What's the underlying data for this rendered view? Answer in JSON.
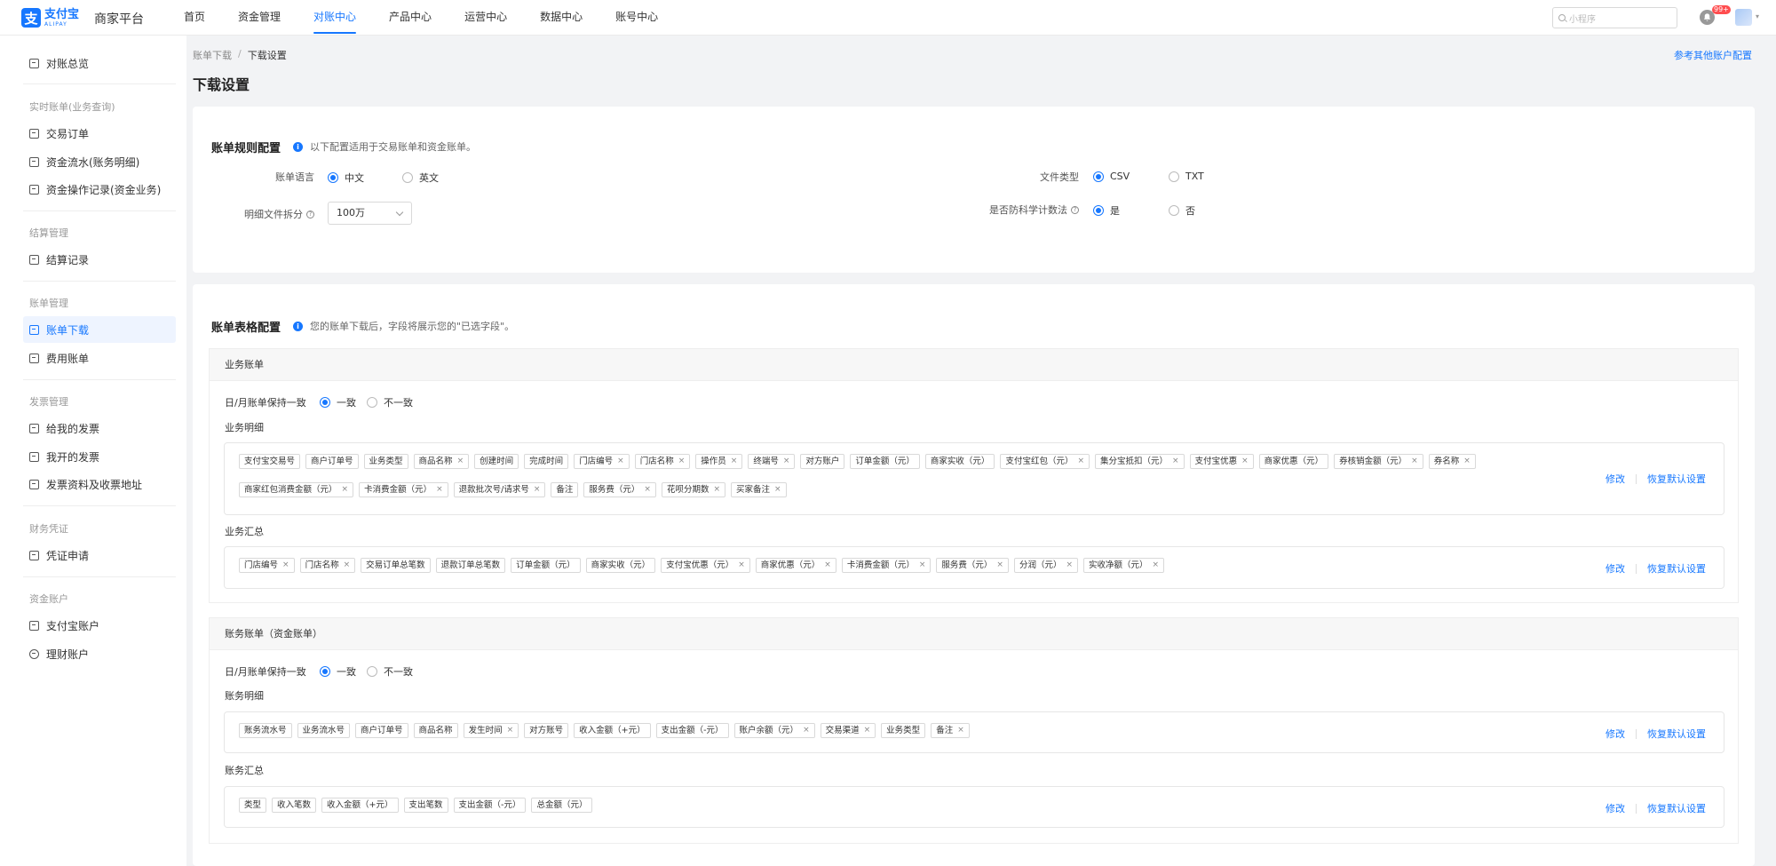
{
  "brand": {
    "logo_cn": "支付宝",
    "logo_en": "ALIPAY",
    "platform": "商家平台",
    "accent": "#1677ff"
  },
  "nav": [
    "首页",
    "资金管理",
    "对账中心",
    "产品中心",
    "运营中心",
    "数据中心",
    "账号中心"
  ],
  "nav_active": "对账中心",
  "search": {
    "placeholder": "小程序"
  },
  "notifications": "99+",
  "sidebar": {
    "top": "对账总览",
    "group1": "实时账单(业务查询)",
    "g1_items": [
      "交易订单",
      "资金流水(账务明细)",
      "资金操作记录(资金业务)"
    ],
    "group2": "结算管理",
    "g2_items": [
      "结算记录"
    ],
    "group3": "账单管理",
    "g3_items": [
      "账单下载",
      "费用账单"
    ],
    "group4": "发票管理",
    "g4_items": [
      "给我的发票",
      "我开的发票",
      "发票资料及收票地址"
    ],
    "group5": "财务凭证",
    "g5_items": [
      "凭证申请"
    ],
    "group6": "资金账户",
    "g6_items": [
      "支付宝账户",
      "理财账户"
    ]
  },
  "breadcrumb": [
    "账单下载",
    "下载设置"
  ],
  "page_title": "下载设置",
  "ref_link": "参考其他账户配置",
  "rules": {
    "title": "账单规则配置",
    "tip": "以下配置适用于交易账单和资金账单。",
    "lang_label": "账单语言",
    "lang_options": [
      "中文",
      "英文"
    ],
    "lang_selected": "中文",
    "split_label": "明细文件拆分",
    "split_value": "100万",
    "filetype_label": "文件类型",
    "filetype_options": [
      "CSV",
      "TXT"
    ],
    "filetype_selected": "CSV",
    "sci_label": "是否防科学计数法",
    "sci_options": [
      "是",
      "否"
    ],
    "sci_selected": "是"
  },
  "table_config": {
    "title": "账单表格配置",
    "tip": "您的账单下载后，字段将展示您的\"已选字段\"。",
    "consistency_label": "日/月账单保持一致",
    "consistency_options": [
      "一致",
      "不一致"
    ],
    "edit": "修改",
    "reset": "恢复默认设置",
    "biz": {
      "title": "业务账单",
      "detail_label": "业务明细",
      "detail_fields": [
        {
          "t": "支付宝交易号",
          "x": false
        },
        {
          "t": "商户订单号",
          "x": false
        },
        {
          "t": "业务类型",
          "x": false
        },
        {
          "t": "商品名称",
          "x": true
        },
        {
          "t": "创建时间",
          "x": false
        },
        {
          "t": "完成时间",
          "x": false
        },
        {
          "t": "门店编号",
          "x": true
        },
        {
          "t": "门店名称",
          "x": true
        },
        {
          "t": "操作员",
          "x": true
        },
        {
          "t": "终端号",
          "x": true
        },
        {
          "t": "对方账户",
          "x": false
        },
        {
          "t": "订单金额（元）",
          "x": false
        },
        {
          "t": "商家实收（元）",
          "x": false
        },
        {
          "t": "支付宝红包（元）",
          "x": true
        },
        {
          "t": "集分宝抵扣（元）",
          "x": true
        },
        {
          "t": "支付宝优惠",
          "x": true
        },
        {
          "t": "商家优惠（元）",
          "x": false
        },
        {
          "t": "券核销金额（元）",
          "x": true
        },
        {
          "t": "券名称",
          "x": true
        },
        {
          "t": "商家红包消费金额（元）",
          "x": true
        },
        {
          "t": "卡消费金额（元）",
          "x": true
        },
        {
          "t": "退款批次号/请求号",
          "x": true
        },
        {
          "t": "备注",
          "x": false
        },
        {
          "t": "服务费（元）",
          "x": true
        },
        {
          "t": "花呗分期数",
          "x": true
        },
        {
          "t": "买家备注",
          "x": true
        }
      ],
      "summary_label": "业务汇总",
      "summary_fields": [
        {
          "t": "门店编号",
          "x": true
        },
        {
          "t": "门店名称",
          "x": true
        },
        {
          "t": "交易订单总笔数",
          "x": false
        },
        {
          "t": "退款订单总笔数",
          "x": false
        },
        {
          "t": "订单金额（元）",
          "x": false
        },
        {
          "t": "商家实收（元）",
          "x": false
        },
        {
          "t": "支付宝优惠（元）",
          "x": true
        },
        {
          "t": "商家优惠（元）",
          "x": true
        },
        {
          "t": "卡消费金额（元）",
          "x": true
        },
        {
          "t": "服务费（元）",
          "x": true
        },
        {
          "t": "分润（元）",
          "x": true
        },
        {
          "t": "实收净额（元）",
          "x": true
        }
      ]
    },
    "acct": {
      "title": "账务账单（资金账单）",
      "detail_label": "账务明细",
      "detail_fields": [
        {
          "t": "账务流水号",
          "x": false
        },
        {
          "t": "业务流水号",
          "x": false
        },
        {
          "t": "商户订单号",
          "x": false
        },
        {
          "t": "商品名称",
          "x": false
        },
        {
          "t": "发生时间",
          "x": true
        },
        {
          "t": "对方账号",
          "x": false
        },
        {
          "t": "收入金额（+元）",
          "x": false
        },
        {
          "t": "支出金额（-元）",
          "x": false
        },
        {
          "t": "账户余额（元）",
          "x": true
        },
        {
          "t": "交易渠道",
          "x": true
        },
        {
          "t": "业务类型",
          "x": false
        },
        {
          "t": "备注",
          "x": true
        }
      ],
      "summary_label": "账务汇总",
      "summary_fields": [
        {
          "t": "类型",
          "x": false
        },
        {
          "t": "收入笔数",
          "x": false
        },
        {
          "t": "收入金额（+元）",
          "x": false
        },
        {
          "t": "支出笔数",
          "x": false
        },
        {
          "t": "支出金额（-元）",
          "x": false
        },
        {
          "t": "总金额（元）",
          "x": false
        }
      ]
    }
  }
}
